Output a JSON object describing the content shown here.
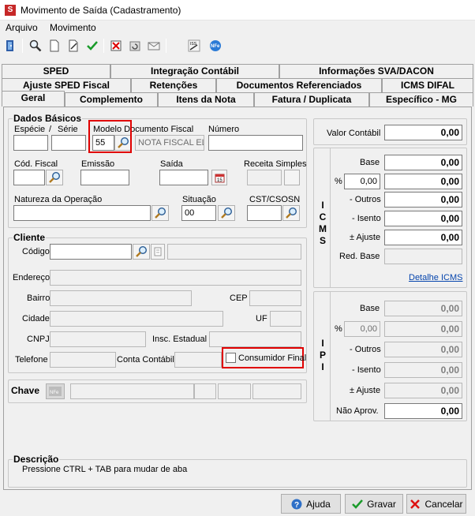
{
  "window": {
    "title": "Movimento de Saída (Cadastramento)"
  },
  "menu": {
    "arquivo": "Arquivo",
    "movimento": "Movimento"
  },
  "tabs": {
    "row1": [
      "SPED",
      "Integração Contábil",
      "Informações SVA/DACON"
    ],
    "row2": [
      "Ajuste SPED Fiscal",
      "Retenções",
      "Documentos Referenciados",
      "ICMS DIFAL"
    ],
    "row3": [
      "Geral",
      "Complemento",
      "Itens da Nota",
      "Fatura / Duplicata",
      "Específico - MG"
    ]
  },
  "dados_basicos": {
    "title": "Dados Básicos",
    "especie_label": "Espécie",
    "serie_sep": "/",
    "serie_label": "Série",
    "modelo_label": "Modelo Documento Fiscal",
    "modelo_value": "55",
    "modelo_desc": "NOTA FISCAL EL",
    "numero_label": "Número",
    "cod_fiscal_label": "Cód. Fiscal",
    "emissao_label": "Emissão",
    "saida_label": "Saída",
    "receita_label": "Receita Simples",
    "natureza_label": "Natureza da Operação",
    "situacao_label": "Situação",
    "situacao_value": "00",
    "cst_label": "CST/CSOSN"
  },
  "cliente": {
    "title": "Cliente",
    "codigo_label": "Código",
    "endereco_label": "Endereço",
    "bairro_label": "Bairro",
    "cep_label": "CEP",
    "cidade_label": "Cidade",
    "uf_label": "UF",
    "cnpj_label": "CNPJ",
    "insc_label": "Insc. Estadual",
    "telefone_label": "Telefone",
    "conta_label": "Conta Contábil",
    "consumidor_label": "Consumidor Final"
  },
  "chave": {
    "label": "Chave"
  },
  "valor_contabil": {
    "label": "Valor Contábil",
    "value": "0,00"
  },
  "icms": {
    "vlabel": [
      "I",
      "C",
      "M",
      "S"
    ],
    "base_label": "Base",
    "base_value": "0,00",
    "pct_label": "%",
    "pct_value": "0,00",
    "pct_result": "0,00",
    "outros_label": "- Outros",
    "outros_value": "0,00",
    "isento_label": "- Isento",
    "isento_value": "0,00",
    "ajuste_label": "± Ajuste",
    "ajuste_value": "0,00",
    "red_base_label": "Red. Base",
    "detalhe_link": "Detalhe ICMS"
  },
  "ipi": {
    "vlabel": [
      "I",
      "P",
      "I"
    ],
    "base_label": "Base",
    "base_value": "0,00",
    "pct_label": "%",
    "pct_value": "0,00",
    "pct_result": "0,00",
    "outros_label": "- Outros",
    "outros_value": "0,00",
    "isento_label": "- Isento",
    "isento_value": "0,00",
    "ajuste_label": "± Ajuste",
    "ajuste_value": "0,00",
    "nao_aprov_label": "Não Aprov.",
    "nao_aprov_value": "0,00"
  },
  "descricao": {
    "title": "Descrição",
    "text": "Pressione CTRL + TAB para  mudar de aba"
  },
  "buttons": {
    "ajuda": "Ajuda",
    "gravar": "Gravar",
    "cancelar": "Cancelar"
  },
  "icons": {
    "toolbar": [
      "exit-door-icon",
      "search-icon",
      "new-document-icon",
      "edit-document-icon",
      "confirm-check-icon",
      "delete-icon",
      "refresh-icon",
      "mail-icon",
      "iss-sign-icon",
      "nfe-icon"
    ]
  },
  "colors": {
    "highlight": "#e00000",
    "link": "#0645ad"
  }
}
